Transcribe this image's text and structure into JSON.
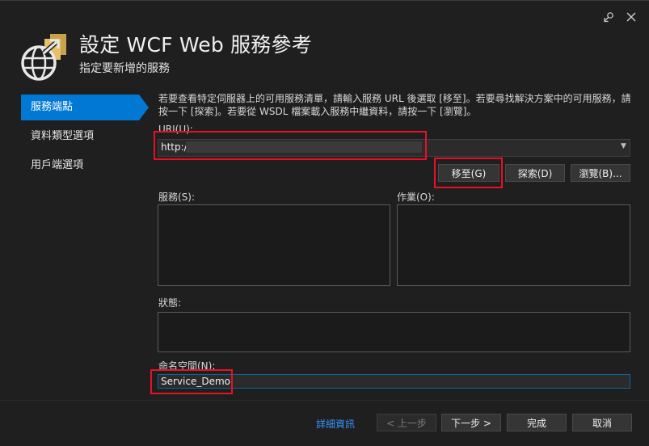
{
  "header": {
    "title": "設定 WCF Web 服務參考",
    "subtitle": "指定要新增的服務"
  },
  "nav": {
    "items": [
      {
        "label": "服務端點",
        "active": true
      },
      {
        "label": "資料類型選項",
        "active": false
      },
      {
        "label": "用戶端選項",
        "active": false
      }
    ]
  },
  "main": {
    "description": "若要查看特定伺服器上的可用服務清單，請輸入服務 URL 後選取 [移至]。若要尋找解決方案中的可用服務，請按一下 [探索]。若要從 WSDL 檔案載入服務中繼資料，請按一下 [瀏覽]。",
    "uri_label": "URI(U):",
    "uri_value": "http:/",
    "go_button": "移至(G)",
    "discover_button": "探索(D)",
    "browse_button": "瀏覽(B)...",
    "services_label": "服務(S):",
    "operations_label": "作業(O):",
    "status_label": "狀態:",
    "namespace_label": "命名空間(N):",
    "namespace_value": "Service_Demo"
  },
  "footer": {
    "details_link": "詳細資訊",
    "previous_button": "< 上一步",
    "next_button": "下一步 >",
    "finish_button": "完成",
    "cancel_button": "取消"
  },
  "colors": {
    "accent": "#0078d4",
    "highlight": "#e81123",
    "link": "#3794ff"
  }
}
